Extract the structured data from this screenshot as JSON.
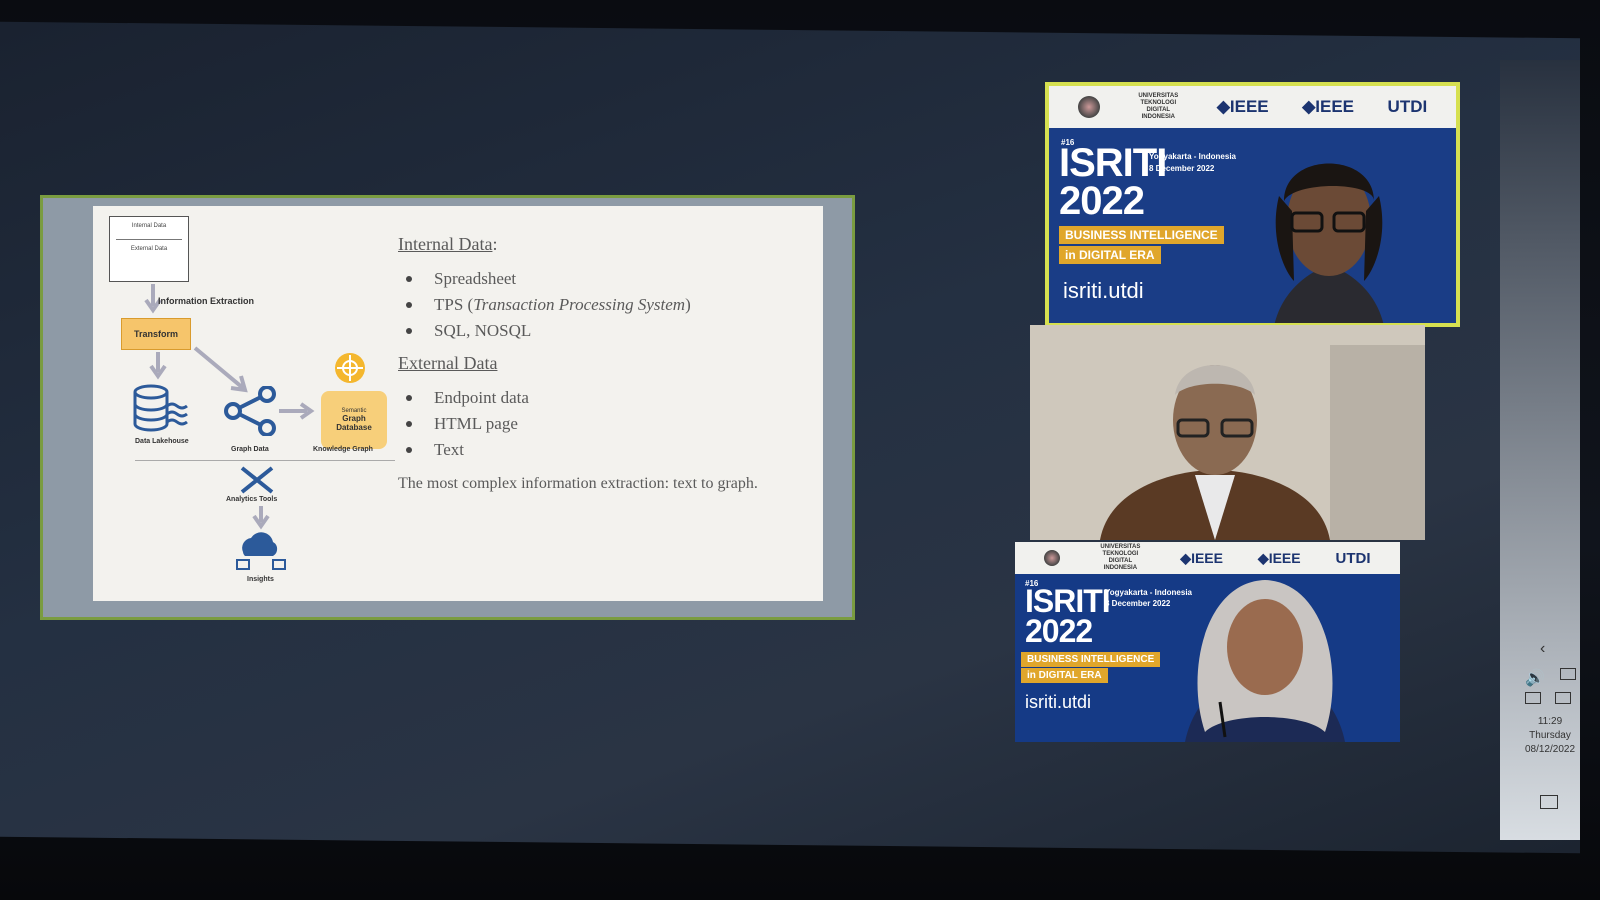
{
  "slide": {
    "diagram": {
      "internal_data_box": "Internal Data",
      "external_data_box": "External Data",
      "information_extraction": "Information Extraction",
      "transform": "Transform",
      "data_lakehouse": "Data Lakehouse",
      "graph_data": "Graph Data",
      "semantic": "Semantic",
      "graph_database": "Graph Database",
      "knowledge_graph": "Knowledge Graph",
      "analytics_tools": "Analytics Tools",
      "insights": "Insights"
    },
    "internal_heading": "Internal Data",
    "internal_heading_suffix": ":",
    "internal_items": [
      "Spreadsheet",
      "TPS (",
      "Transaction Processing System",
      ")",
      "SQL, NOSQL"
    ],
    "external_heading": "External Data",
    "external_items": [
      "Endpoint data",
      "HTML page",
      "Text"
    ],
    "note": "The most complex information extraction: text to graph."
  },
  "tiles": [
    {
      "banner": {
        "univ": "UNIVERSITAS TEKNOLOGI DIGITAL INDONESIA",
        "ieee1": "IEEE",
        "ieee2": "IEEE",
        "utdi": "UTDI"
      },
      "edition": "#16",
      "title_line1": "ISRITI",
      "title_line2": "2022",
      "location": "Yogyakarta - Indonesia",
      "date": "8 December 2022",
      "theme_line1": "BUSINESS INTELLIGENCE",
      "theme_line2": "in DIGITAL ERA",
      "site": "isriti.utdi"
    },
    {},
    {
      "banner": {
        "univ": "UNIVERSITAS TEKNOLOGI DIGITAL INDONESIA",
        "ieee1": "IEEE",
        "ieee2": "IEEE",
        "utdi": "UTDI"
      },
      "edition": "#16",
      "title_line1": "ISRITI",
      "title_line2": "2022",
      "location": "Yogyakarta - Indonesia",
      "date": "8 December 2022",
      "theme_line1": "BUSINESS INTELLIGENCE",
      "theme_line2": "in DIGITAL ERA",
      "site": "isriti.utdi"
    }
  ],
  "tray": {
    "time": "11:29",
    "day": "Thursday",
    "date": "08/12/2022"
  }
}
